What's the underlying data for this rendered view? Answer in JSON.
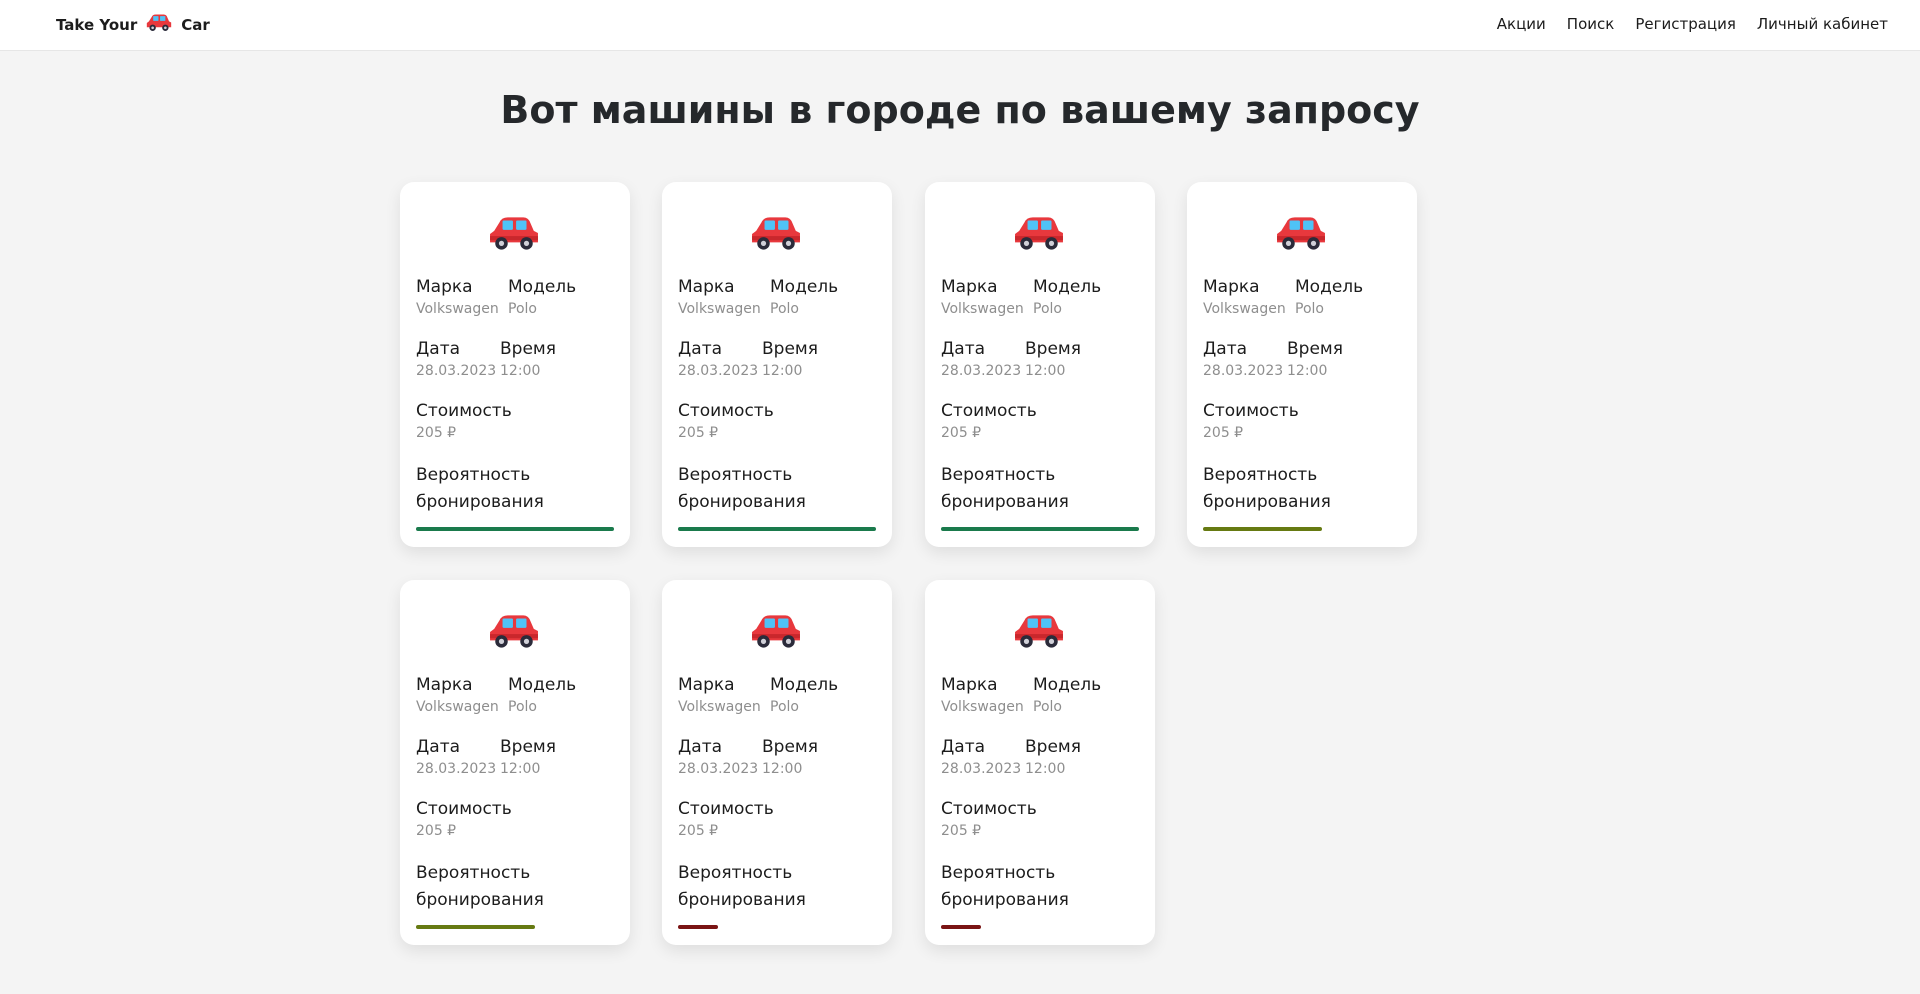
{
  "header": {
    "brand_left": "Take Your",
    "brand_right": "Car",
    "brand_icon": "car-icon",
    "nav": [
      "Акции",
      "Поиск",
      "Регистрация",
      "Личный кабинет"
    ]
  },
  "title": "Вот машины в городе по вашему запросу",
  "labels": {
    "brand": "Марка",
    "model": "Модель",
    "date": "Дата",
    "time": "Время",
    "price": "Стоимость",
    "probability": "Вероятность бронирования"
  },
  "colors": {
    "high": "#1a7a4c",
    "medium": "#667a12",
    "low": "#7a1414"
  },
  "cars": [
    {
      "brand": "Volkswagen",
      "model": "Polo",
      "date": "28.03.2023",
      "time": "12:00",
      "price": "205 ₽",
      "probability": 1.0,
      "level": "high"
    },
    {
      "brand": "Volkswagen",
      "model": "Polo",
      "date": "28.03.2023",
      "time": "12:00",
      "price": "205 ₽",
      "probability": 1.0,
      "level": "high"
    },
    {
      "brand": "Volkswagen",
      "model": "Polo",
      "date": "28.03.2023",
      "time": "12:00",
      "price": "205 ₽",
      "probability": 1.0,
      "level": "high"
    },
    {
      "brand": "Volkswagen",
      "model": "Polo",
      "date": "28.03.2023",
      "time": "12:00",
      "price": "205 ₽",
      "probability": 0.6,
      "level": "medium"
    },
    {
      "brand": "Volkswagen",
      "model": "Polo",
      "date": "28.03.2023",
      "time": "12:00",
      "price": "205 ₽",
      "probability": 0.6,
      "level": "medium"
    },
    {
      "brand": "Volkswagen",
      "model": "Polo",
      "date": "28.03.2023",
      "time": "12:00",
      "price": "205 ₽",
      "probability": 0.2,
      "level": "low"
    },
    {
      "brand": "Volkswagen",
      "model": "Polo",
      "date": "28.03.2023",
      "time": "12:00",
      "price": "205 ₽",
      "probability": 0.2,
      "level": "low"
    }
  ]
}
